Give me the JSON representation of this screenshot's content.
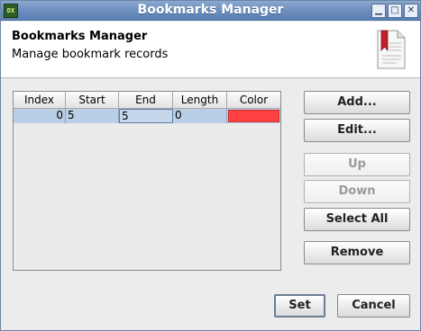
{
  "window": {
    "title": "Bookmarks Manager",
    "app_icon_text": "DX",
    "controls": {
      "minimize": "▁",
      "maximize": "□",
      "close": "✕"
    }
  },
  "header": {
    "title": "Bookmarks Manager",
    "subtitle": "Manage bookmark records",
    "icon": "bookmark-document-icon"
  },
  "table": {
    "columns": [
      "Index",
      "Start",
      "End",
      "Length",
      "Color"
    ],
    "rows": [
      {
        "index": "0",
        "start": "5",
        "end": "5",
        "length": "0",
        "color": "#ff4040"
      }
    ],
    "selected_row": 0
  },
  "side_buttons": {
    "add": "Add...",
    "edit": "Edit...",
    "up": "Up",
    "down": "Down",
    "select_all": "Select All",
    "remove": "Remove"
  },
  "footer_buttons": {
    "set": "Set",
    "cancel": "Cancel"
  },
  "colors": {
    "selection": "#b8cfe5",
    "bookmark_color": "#ff4040",
    "titlebar": "#6b8dbe"
  }
}
